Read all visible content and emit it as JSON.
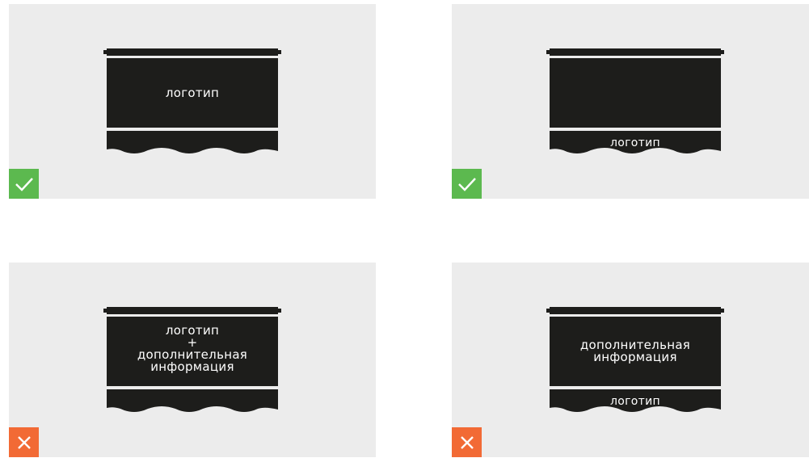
{
  "panels": [
    {
      "main_lines": [
        "логотип"
      ],
      "band_text": "",
      "verdict": "correct",
      "verdict_icon": "check-icon",
      "verdict_color": "#5cb94f"
    },
    {
      "main_lines": [],
      "band_text": "логотип",
      "verdict": "correct",
      "verdict_icon": "check-icon",
      "verdict_color": "#5cb94f"
    },
    {
      "main_lines": [
        "логотип",
        "+",
        "дополнительная",
        "информация"
      ],
      "band_text": "",
      "verdict": "incorrect",
      "verdict_icon": "cross-icon",
      "verdict_color": "#f26a35"
    },
    {
      "main_lines": [
        "дополнительная",
        "информация"
      ],
      "band_text": "логотип",
      "verdict": "incorrect",
      "verdict_icon": "cross-icon",
      "verdict_color": "#f26a35"
    }
  ],
  "colors": {
    "panel_bg": "#ececec",
    "awning": "#1d1d1b",
    "text": "#ffffff"
  }
}
